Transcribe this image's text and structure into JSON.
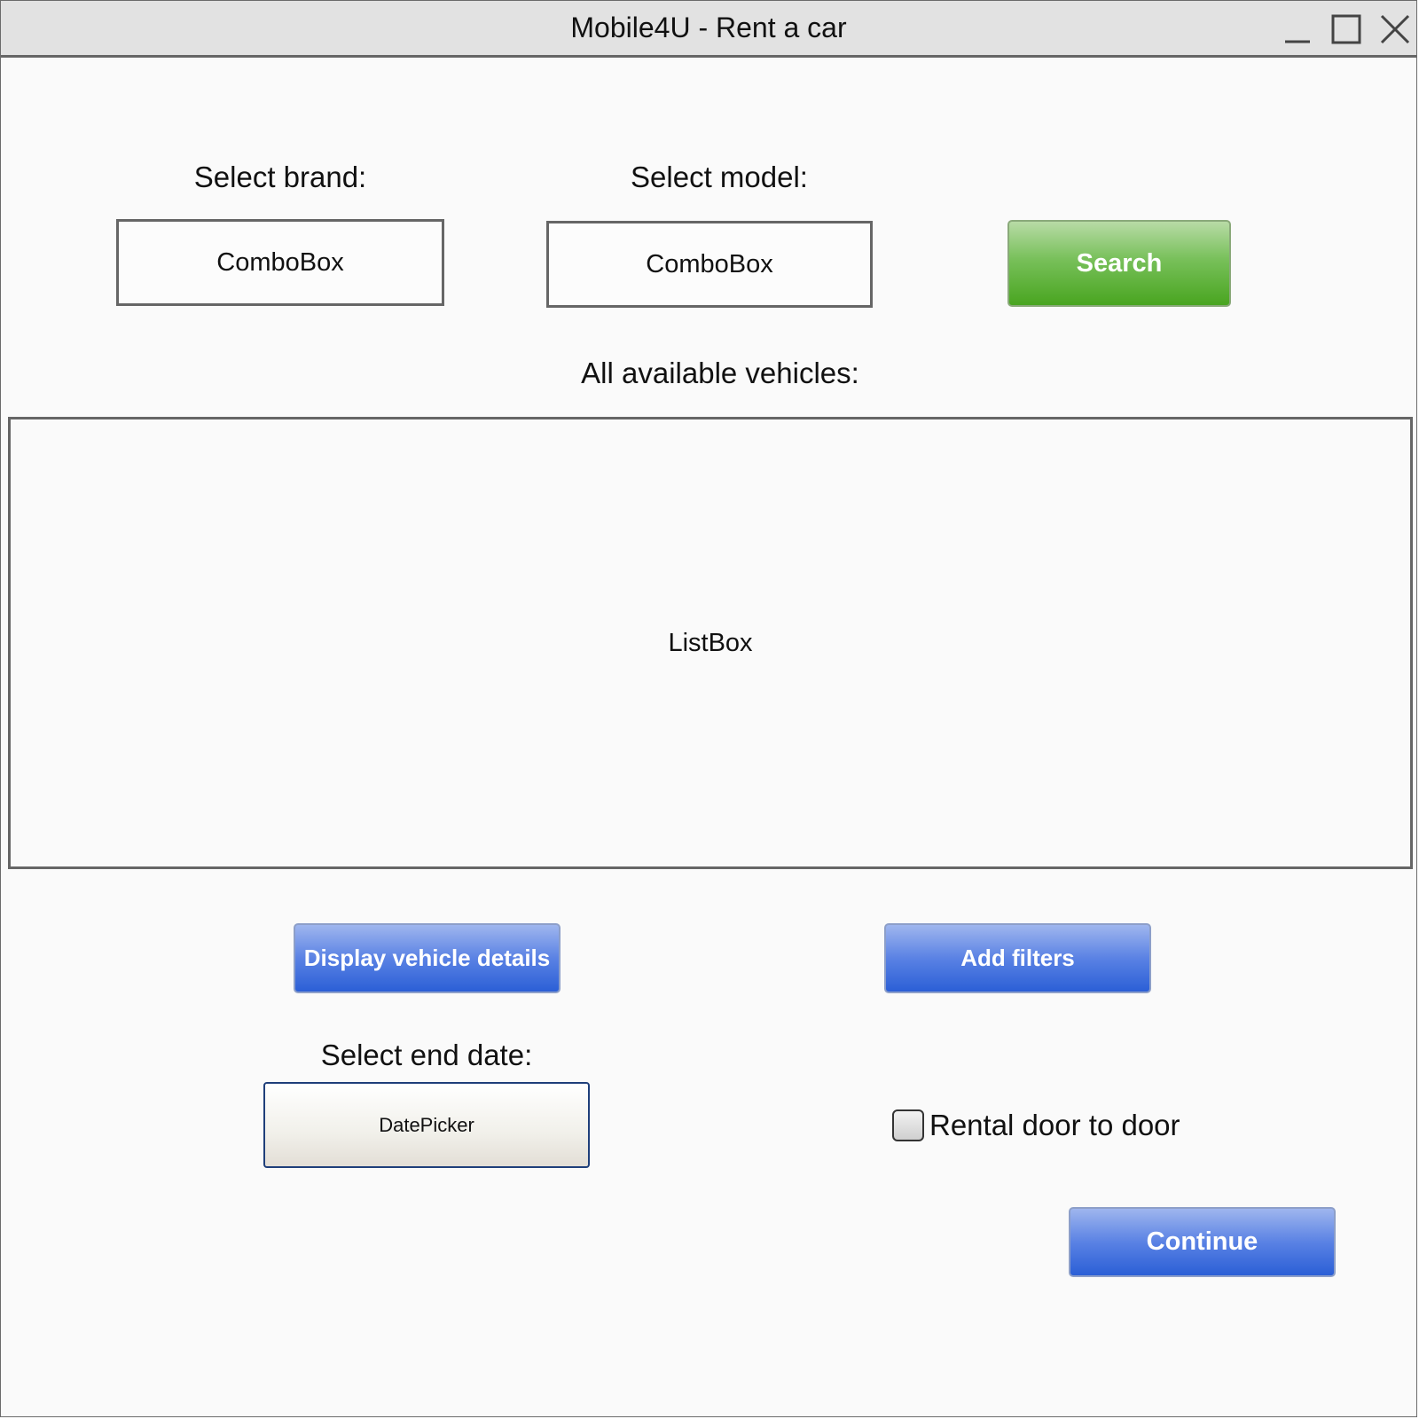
{
  "window": {
    "title": "Mobile4U - Rent a car"
  },
  "brand": {
    "label": "Select brand:",
    "combobox_text": "ComboBox"
  },
  "model": {
    "label": "Select model:",
    "combobox_text": "ComboBox"
  },
  "search_button": "Search",
  "vehicles": {
    "label": "All available vehicles:",
    "listbox_text": "ListBox"
  },
  "display_details_button": "Display vehicle details",
  "add_filters_button": "Add filters",
  "end_date": {
    "label": "Select end date:",
    "datepicker_text": "DatePicker"
  },
  "door_to_door": {
    "label": "Rental door to door",
    "checked": false
  },
  "continue_button": "Continue",
  "colors": {
    "search_green": "#49a520",
    "button_blue": "#2b5fd6"
  },
  "icons": [
    "minimize-icon",
    "maximize-icon",
    "close-icon"
  ]
}
